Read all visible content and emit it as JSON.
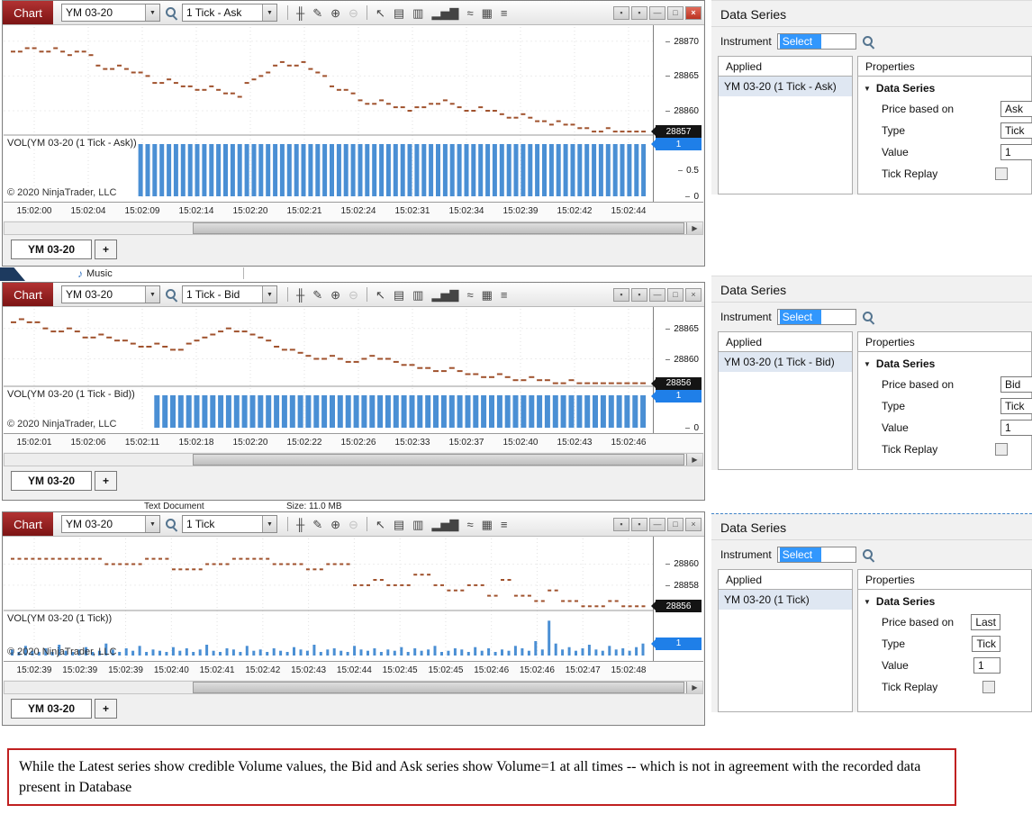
{
  "colors": {
    "series": "#a0522d",
    "volume": "#4a8fd4",
    "badge_price_bg": "#141414",
    "badge_vol_bg": "#1f7fe8",
    "note_border": "#c02020",
    "selection_blue": "#3297fd"
  },
  "ui": {
    "add_tab_label": "+",
    "scroll_right": "▶"
  },
  "toolbar": {
    "icons": [
      {
        "separator": true
      },
      {
        "name": "indicators-icon",
        "glyph": "╫"
      },
      {
        "name": "draw-tools-icon",
        "glyph": "✎"
      },
      {
        "name": "zoom-in-icon",
        "glyph": "⊕"
      },
      {
        "name": "zoom-out-icon",
        "glyph": "⊖",
        "disabled": true
      },
      {
        "separator": true
      },
      {
        "name": "cursor-icon",
        "glyph": "↖"
      },
      {
        "name": "page-icon",
        "glyph": "▤"
      },
      {
        "name": "chart-panel-icon",
        "glyph": "▥"
      },
      {
        "name": "bar-chart-icon",
        "glyph": "▂▅▇"
      },
      {
        "name": "line-style-icon",
        "glyph": "≈"
      },
      {
        "name": "strategies-icon",
        "glyph": "▦"
      },
      {
        "name": "properties-list-icon",
        "glyph": "≡"
      }
    ]
  },
  "window_buttons": [
    {
      "name": "instrument-link-button",
      "glyph": "▪"
    },
    {
      "name": "interval-link-button",
      "glyph": "▪"
    },
    {
      "name": "minimize-button",
      "glyph": "—"
    },
    {
      "name": "maximize-button",
      "glyph": "□"
    },
    {
      "name": "close-button",
      "glyph": "×"
    }
  ],
  "charts": [
    {
      "window_label": "Chart",
      "instrument": "YM 03-20",
      "series": "1 Tick - Ask",
      "vol_label": "VOL(YM 03-20 (1 Tick - Ask))",
      "copyright": "© 2020 NinjaTrader, LLC",
      "tab": "YM 03-20"
    },
    {
      "window_label": "Chart",
      "instrument": "YM 03-20",
      "series": "1 Tick - Bid",
      "vol_label": "VOL(YM 03-20 (1 Tick - Bid))",
      "copyright": "© 2020 NinjaTrader, LLC",
      "tab": "YM 03-20"
    },
    {
      "window_label": "Chart",
      "instrument": "YM 03-20",
      "series": "1 Tick",
      "vol_label": "VOL(YM 03-20 (1 Tick))",
      "copyright": "© 2020 NinjaTrader, LLC",
      "tab": "YM 03-20"
    }
  ],
  "chart_data": [
    {
      "type": "scatter",
      "series_name": "YM 03-20 (1 Tick - Ask)",
      "price_max": 28872.3,
      "price_min": 28856.5,
      "price_ticks": [
        "28870",
        "28865",
        "28860"
      ],
      "last_price": 28857,
      "last_price_label": "28857",
      "vol_max": 1,
      "vol_last": 1,
      "vol_last_label": "1",
      "vol_ticks": [
        {
          "value": 0.5,
          "label": "0.5"
        },
        {
          "value": 0,
          "label": "0"
        }
      ],
      "volumes": {
        "uniform": 1,
        "zero_until": 18
      },
      "prices": [
        28868.5,
        28868.5,
        28869,
        28869,
        28868.5,
        28868.5,
        28869,
        28868.5,
        28868,
        28868.5,
        28868.5,
        28868,
        28866.5,
        28866,
        28866,
        28866.5,
        28866,
        28865.5,
        28865.5,
        28865,
        28864,
        28864,
        28864.5,
        28864,
        28863.5,
        28863.5,
        28863,
        28863,
        28863.5,
        28863,
        28862.5,
        28862.5,
        28862,
        28864,
        28864.5,
        28865,
        28865.5,
        28866.5,
        28867,
        28866.5,
        28866.5,
        28867,
        28866,
        28865.5,
        28865,
        28863.5,
        28863,
        28863,
        28862.5,
        28861.5,
        28861,
        28861,
        28861.5,
        28861,
        28860.5,
        28860.5,
        28860,
        28860.5,
        28860.5,
        28861,
        28861,
        28861.5,
        28861,
        28860.5,
        28860,
        28860,
        28860.5,
        28860,
        28860,
        28859.5,
        28859,
        28859,
        28859.5,
        28859,
        28858.5,
        28858.5,
        28858,
        28858.5,
        28858,
        28858,
        28857.5,
        28857.5,
        28857,
        28857,
        28857.5,
        28857,
        28857,
        28857,
        28857,
        28857
      ],
      "time_labels": [
        "15:02:00",
        "15:02:04",
        "15:02:09",
        "15:02:14",
        "15:02:20",
        "15:02:21",
        "15:02:24",
        "15:02:31",
        "15:02:34",
        "15:02:39",
        "15:02:42",
        "15:02:44"
      ]
    },
    {
      "type": "scatter",
      "series_name": "YM 03-20 (1 Tick - Bid)",
      "price_max": 28868.5,
      "price_min": 28855.5,
      "price_ticks": [
        "28865",
        "28860"
      ],
      "last_price": 28856,
      "last_price_label": "28856",
      "vol_max": 1,
      "vol_last": 1,
      "vol_last_label": "1",
      "vol_ticks": [
        {
          "value": 0,
          "label": "0"
        }
      ],
      "volumes": {
        "uniform": 1,
        "zero_until": 18
      },
      "prices": [
        28866,
        28866.5,
        28866,
        28866,
        28865,
        28864.5,
        28864.5,
        28865,
        28864.5,
        28863.5,
        28863.5,
        28864,
        28863.5,
        28863,
        28863,
        28862.5,
        28862,
        28862,
        28862.5,
        28862,
        28861.5,
        28861.5,
        28862.5,
        28863,
        28863.5,
        28864,
        28864.5,
        28865,
        28864.5,
        28864.5,
        28864,
        28863.5,
        28863,
        28862,
        28861.5,
        28861.5,
        28861,
        28860.5,
        28860,
        28860,
        28860.5,
        28860,
        28859.5,
        28859.5,
        28860,
        28860.5,
        28860,
        28860,
        28859.5,
        28859,
        28859,
        28858.5,
        28858.5,
        28858,
        28858,
        28858.5,
        28858,
        28857.5,
        28857.5,
        28857,
        28857,
        28857.5,
        28857,
        28856.5,
        28856.5,
        28857,
        28856.5,
        28856.5,
        28856,
        28856,
        28856.5,
        28856,
        28856,
        28856,
        28856,
        28856,
        28856,
        28856,
        28856,
        28856
      ],
      "time_labels": [
        "15:02:01",
        "15:02:06",
        "15:02:11",
        "15:02:18",
        "15:02:20",
        "15:02:22",
        "15:02:26",
        "15:02:33",
        "15:02:37",
        "15:02:40",
        "15:02:43",
        "15:02:46"
      ]
    },
    {
      "type": "scatter",
      "series_name": "YM 03-20 (1 Tick)",
      "price_max": 28862.6,
      "price_min": 28855.6,
      "price_ticks": [
        "28860",
        "28858"
      ],
      "last_price": 28856,
      "last_price_label": "28856",
      "vol_max": 3,
      "vol_last": 1,
      "vol_last_label": "1",
      "vol_ticks": [],
      "volumes": [
        0.5,
        0.3,
        0.8,
        0.4,
        0.3,
        0.6,
        0.3,
        0.9,
        0.4,
        0.3,
        0.5,
        0.7,
        0.3,
        0.4,
        1.0,
        0.5,
        0.3,
        0.6,
        0.4,
        0.8,
        0.3,
        0.5,
        0.4,
        0.3,
        0.7,
        0.4,
        0.6,
        0.3,
        0.5,
        0.9,
        0.4,
        0.3,
        0.6,
        0.5,
        0.3,
        0.8,
        0.4,
        0.5,
        0.3,
        0.6,
        0.4,
        0.3,
        0.7,
        0.5,
        0.4,
        0.9,
        0.3,
        0.5,
        0.6,
        0.4,
        0.3,
        0.8,
        0.5,
        0.4,
        0.6,
        0.3,
        0.5,
        0.4,
        0.7,
        0.3,
        0.6,
        0.4,
        0.5,
        0.8,
        0.3,
        0.4,
        0.6,
        0.5,
        0.3,
        0.7,
        0.4,
        0.6,
        0.3,
        0.5,
        0.4,
        0.8,
        0.6,
        0.4,
        1.2,
        0.5,
        2.9,
        1.0,
        0.5,
        0.7,
        0.4,
        0.6,
        0.9,
        0.5,
        0.4,
        0.8,
        0.5,
        0.6,
        0.4,
        0.7,
        1.0
      ],
      "prices": [
        28860.5,
        28860.5,
        28860.5,
        28860.5,
        28860.5,
        28860.5,
        28860.5,
        28860.5,
        28860.5,
        28860.5,
        28860.5,
        28860.5,
        28860.5,
        28860.5,
        28860,
        28860,
        28860,
        28860,
        28860,
        28860,
        28860.5,
        28860.5,
        28860.5,
        28860.5,
        28859.5,
        28859.5,
        28859.5,
        28859.5,
        28859.5,
        28860,
        28860,
        28860,
        28860,
        28860.5,
        28860.5,
        28860.5,
        28860.5,
        28860.5,
        28860.5,
        28860,
        28860,
        28860,
        28860,
        28860,
        28859.5,
        28859.5,
        28859.5,
        28860,
        28860,
        28860,
        28860,
        28858,
        28858,
        28858,
        28858.5,
        28858.5,
        28858,
        28858,
        28858,
        28858,
        28859,
        28859,
        28859,
        28858,
        28858,
        28857.5,
        28857.5,
        28857.5,
        28858,
        28858,
        28858,
        28857,
        28857,
        28858.5,
        28858.5,
        28857,
        28857,
        28857,
        28856.5,
        28856.5,
        28857.5,
        28857.5,
        28856.5,
        28856.5,
        28856.5,
        28856,
        28856,
        28856,
        28856,
        28856.5,
        28856.5,
        28856,
        28856,
        28856,
        28856
      ],
      "time_labels": [
        "15:02:39",
        "15:02:39",
        "15:02:39",
        "15:02:40",
        "15:02:41",
        "15:02:42",
        "15:02:43",
        "15:02:44",
        "15:02:45",
        "15:02:45",
        "15:02:46",
        "15:02:46",
        "15:02:47",
        "15:02:48"
      ]
    }
  ],
  "panels": [
    {
      "title": "Data Series",
      "instrument_label": "Instrument",
      "instrument_value": "Select",
      "applied_header": "Applied",
      "properties_header": "Properties",
      "section_label": "Data Series",
      "applied_item": "YM 03-20 (1 Tick - Ask)",
      "rows": [
        {
          "label": "Price based on",
          "value": "Ask"
        },
        {
          "label": "Type",
          "value": "Tick"
        },
        {
          "label": "Value",
          "value": "1"
        },
        {
          "label": "Tick Replay",
          "checkbox": true
        }
      ]
    },
    {
      "title": "Data Series",
      "instrument_label": "Instrument",
      "instrument_value": "Select",
      "applied_header": "Applied",
      "properties_header": "Properties",
      "section_label": "Data Series",
      "applied_item": "YM 03-20 (1 Tick - Bid)",
      "rows": [
        {
          "label": "Price based on",
          "value": "Bid"
        },
        {
          "label": "Type",
          "value": "Tick"
        },
        {
          "label": "Value",
          "value": "1"
        },
        {
          "label": "Tick Replay",
          "checkbox": true
        }
      ]
    },
    {
      "title": "Data Series",
      "instrument_label": "Instrument",
      "instrument_value": "Select",
      "applied_header": "Applied",
      "properties_header": "Properties",
      "section_label": "Data Series",
      "applied_item": "YM 03-20 (1 Tick)",
      "rows": [
        {
          "label": "Price based on",
          "value": "Last"
        },
        {
          "label": "Type",
          "value": "Tick"
        },
        {
          "label": "Value",
          "value": "1"
        },
        {
          "label": "Tick Replay",
          "checkbox": true
        }
      ]
    }
  ],
  "background": {
    "music_label": "Music",
    "text_document_label": "Text Document",
    "size_label": "Size: 11.0 MB"
  },
  "note": {
    "text": "While the Latest series show credible Volume values, the  Bid and Ask series show Volume=1 at all times -- which is not in agreement with the recorded data present in Database"
  }
}
